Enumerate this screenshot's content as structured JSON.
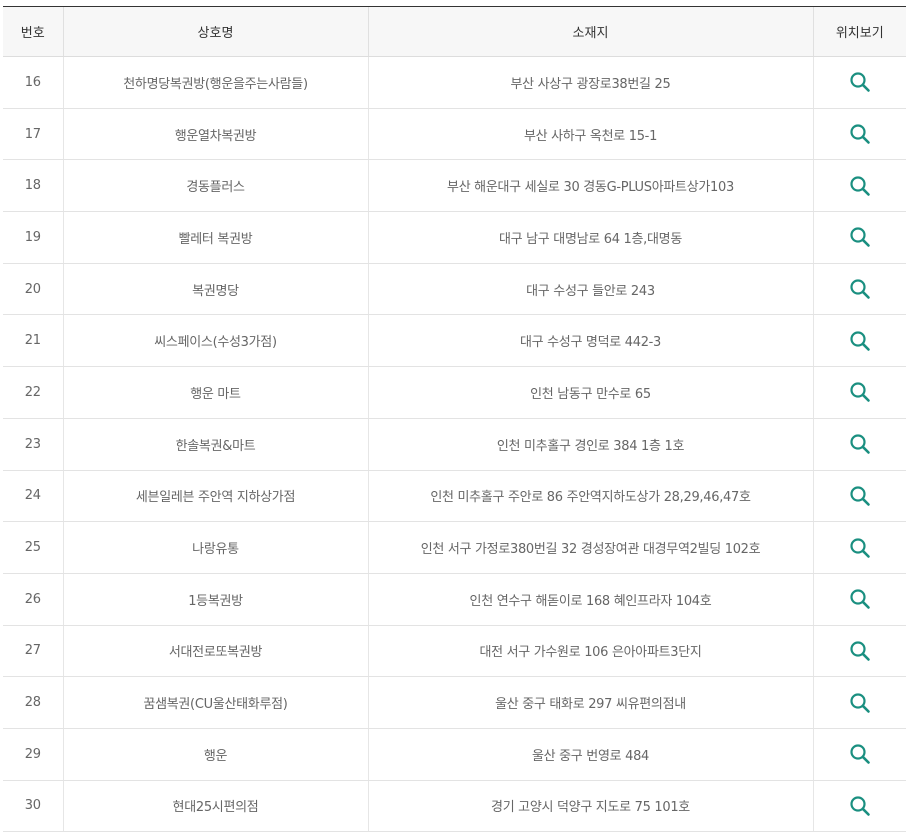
{
  "table": {
    "headers": {
      "number": "번호",
      "name": "상호명",
      "address": "소재지",
      "map": "위치보기"
    },
    "accent_color": "#1a8f80",
    "map_icon": "search-icon",
    "rows": [
      {
        "number": "16",
        "name": "천하명당복권방(행운을주는사람들)",
        "address": "부산 사상구 광장로38번길 25"
      },
      {
        "number": "17",
        "name": "행운열차복권방",
        "address": "부산 사하구 옥천로 15-1"
      },
      {
        "number": "18",
        "name": "경동플러스",
        "address": "부산 해운대구 세실로 30 경동G-PLUS아파트상가103"
      },
      {
        "number": "19",
        "name": "빨레터 복권방",
        "address": "대구 남구 대명남로 64 1층,대명동"
      },
      {
        "number": "20",
        "name": "복권명당",
        "address": "대구 수성구 들안로 243"
      },
      {
        "number": "21",
        "name": "씨스페이스(수성3가점)",
        "address": "대구 수성구 명덕로 442-3"
      },
      {
        "number": "22",
        "name": "행운 마트",
        "address": "인천 남동구 만수로 65"
      },
      {
        "number": "23",
        "name": "한솔복권&마트",
        "address": "인천 미추홀구 경인로 384 1층 1호"
      },
      {
        "number": "24",
        "name": "세븐일레븐 주안역 지하상가점",
        "address": "인천 미추홀구 주안로 86 주안역지하도상가 28,29,46,47호"
      },
      {
        "number": "25",
        "name": "나랑유통",
        "address": "인천 서구 가정로380번길 32 경성장여관 대경무역2빌딩 102호"
      },
      {
        "number": "26",
        "name": "1등복권방",
        "address": "인천 연수구 해돋이로 168 혜인프라자 104호"
      },
      {
        "number": "27",
        "name": "서대전로또복권방",
        "address": "대전 서구 가수원로 106 은아아파트3단지"
      },
      {
        "number": "28",
        "name": "꿈샘복권(CU울산태화루점)",
        "address": "울산 중구 태화로 297 씨유편의점내"
      },
      {
        "number": "29",
        "name": "행운",
        "address": "울산 중구 번영로 484"
      },
      {
        "number": "30",
        "name": "현대25시편의점",
        "address": "경기 고양시 덕양구 지도로 75 101호"
      }
    ]
  }
}
